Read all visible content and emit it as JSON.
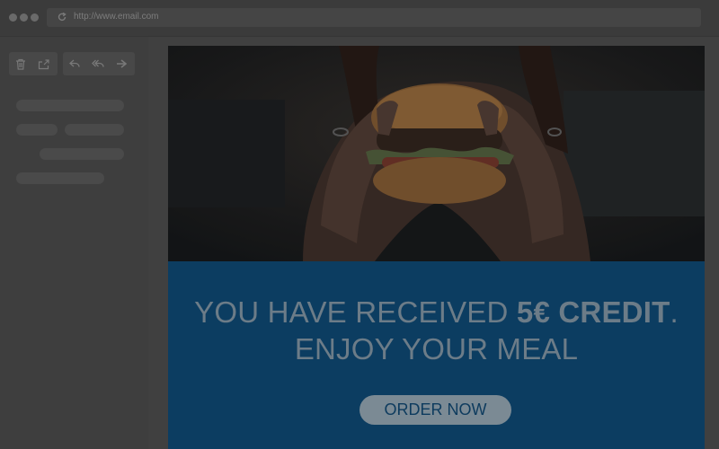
{
  "browser": {
    "url": "http://www.email.com",
    "icons": [
      "window-dot-icon",
      "reload-icon"
    ]
  },
  "toolbar": {
    "icons": [
      "trash-icon",
      "share-icon",
      "reply-icon",
      "reply-all-icon",
      "forward-icon"
    ]
  },
  "email": {
    "hero_image": "burger-photo",
    "headline_part1": "YOU HAVE RECEIVED ",
    "headline_bold": "5€ CREDIT",
    "headline_part2": ".",
    "headline_line2": "ENJOY YOUR MEAL",
    "cta_label": "ORDER NOW"
  },
  "colors": {
    "banner": "#0c3d61",
    "headline_text": "#6c7c88",
    "cta_background": "#7b8a94",
    "cta_text": "#0d3b5e",
    "chrome": "#404040"
  }
}
